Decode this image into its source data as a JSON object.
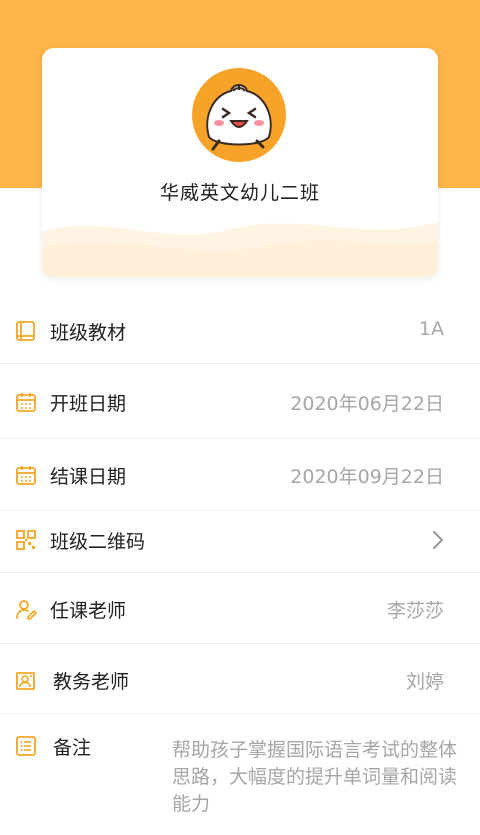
{
  "card": {
    "class_name": "华威英文幼儿二班",
    "avatar_icon": "bun-mascot-icon"
  },
  "rows": {
    "textbook": {
      "label": "班级教材",
      "value": "1A",
      "icon": "book-icon"
    },
    "start_date": {
      "label": "开班日期",
      "value": "2020年06月22日",
      "icon": "calendar-icon"
    },
    "end_date": {
      "label": "结课日期",
      "value": "2020年09月22日",
      "icon": "calendar-icon"
    },
    "qrcode": {
      "label": "班级二维码",
      "icon": "qrcode-icon",
      "action_icon": "chevron-right-icon"
    },
    "teacher": {
      "label": "任课老师",
      "value": "李莎莎",
      "icon": "teacher-icon"
    },
    "admin_teacher": {
      "label": "教务老师",
      "value": "刘婷",
      "icon": "id-card-icon"
    },
    "notes": {
      "label": "备注",
      "value": "帮助孩子掌握国际语言考试的整体思路，大幅度的提升单词量和阅读能力",
      "icon": "list-icon"
    }
  },
  "colors": {
    "accent": "#ffb449",
    "icon": "#f5a623",
    "muted_text": "#a6a6a6"
  }
}
